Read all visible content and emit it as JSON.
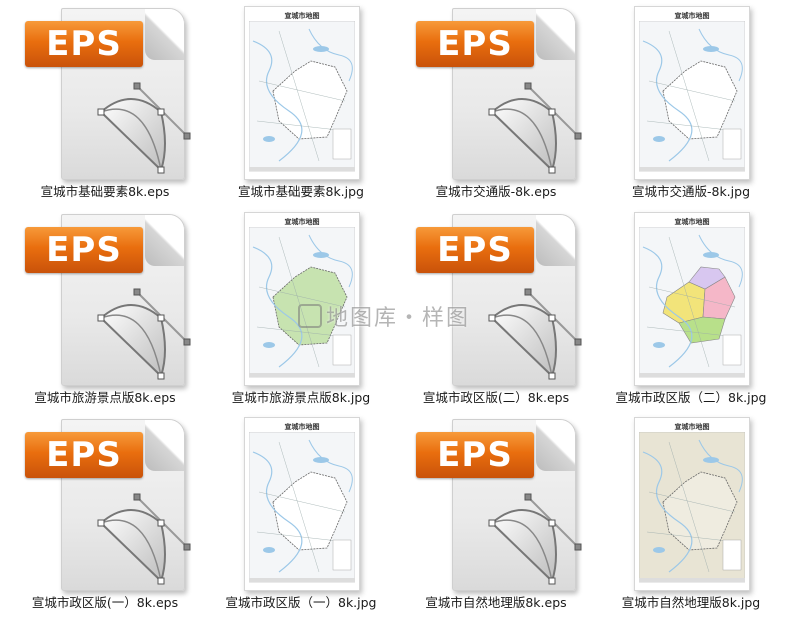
{
  "files": [
    {
      "name": "宣城市基础要素8k.eps",
      "type": "eps"
    },
    {
      "name": "宣城市基础要素8k.jpg",
      "type": "jpg",
      "map_title": "宣城市地图",
      "style": "plain"
    },
    {
      "name": "宣城市交通版-8k.eps",
      "type": "eps"
    },
    {
      "name": "宣城市交通版-8k.jpg",
      "type": "jpg",
      "map_title": "宣城市地图",
      "style": "plain"
    },
    {
      "name": "宣城市旅游景点版8k.eps",
      "type": "eps"
    },
    {
      "name": "宣城市旅游景点版8k.jpg",
      "type": "jpg",
      "map_title": "宣城市地图",
      "style": "green"
    },
    {
      "name": "宣城市政区版(二）8k.eps",
      "type": "eps"
    },
    {
      "name": "宣城市政区版（二）8k.jpg",
      "type": "jpg",
      "map_title": "宣城市地图",
      "style": "colored"
    },
    {
      "name": "宣城市政区版(一）8k.eps",
      "type": "eps"
    },
    {
      "name": "宣城市政区版（一）8k.jpg",
      "type": "jpg",
      "map_title": "宣城市地图",
      "style": "plain"
    },
    {
      "name": "宣城市自然地理版8k.eps",
      "type": "eps"
    },
    {
      "name": "宣城市自然地理版8k.jpg",
      "type": "jpg",
      "map_title": "宣城市地图",
      "style": "terrain"
    }
  ],
  "eps_badge": "EPS",
  "watermark": "地图库・样图",
  "colors": {
    "eps_orange": "#e96e0e",
    "map_water": "#9cc8e8",
    "map_green": "#c7e3b0",
    "map_colored_a": "#f2e47a",
    "map_colored_b": "#f5b7c8",
    "map_colored_c": "#b8e08a",
    "map_terrain": "#e8e4d4"
  }
}
